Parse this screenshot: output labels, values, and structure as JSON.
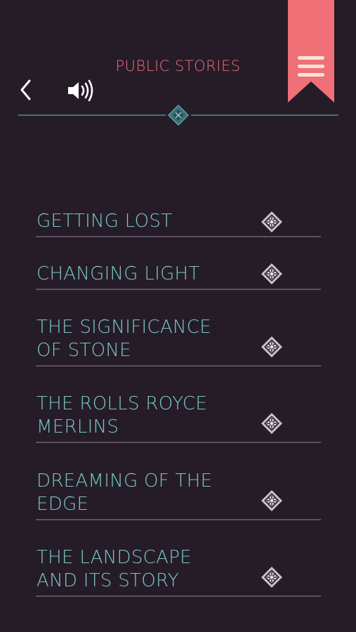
{
  "header": {
    "title": "PUBLIC STORIES",
    "back_icon": "chevron-left-icon",
    "sound_icon": "speaker-icon",
    "menu_icon": "hamburger-menu-icon",
    "bookmark_color": "#f07077"
  },
  "stories": [
    {
      "title": "GETTING LOST",
      "icon": "diamond-ornament-icon"
    },
    {
      "title": "CHANGING LIGHT",
      "icon": "diamond-ornament-icon"
    },
    {
      "title": "THE SIGNIFICANCE OF STONE",
      "icon": "diamond-ornament-icon"
    },
    {
      "title": "THE ROLLS ROYCE MERLINS",
      "icon": "diamond-ornament-icon"
    },
    {
      "title": "DREAMING OF THE EDGE",
      "icon": "diamond-ornament-icon"
    },
    {
      "title": "THE LANDSCAPE AND ITS STORY",
      "icon": "diamond-ornament-icon"
    }
  ],
  "colors": {
    "background": "#261c28",
    "accent": "#e8707a",
    "story_text": "#7ac8c2",
    "rule": "#5b5061",
    "divider": "#4f8c92"
  }
}
